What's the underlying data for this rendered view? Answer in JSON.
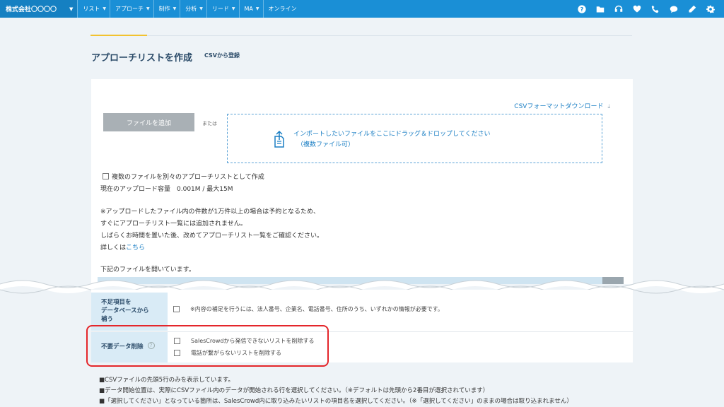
{
  "nav": {
    "brand": "株式会社〇〇〇〇",
    "menu": [
      {
        "label": "リスト",
        "has_dropdown": true
      },
      {
        "label": "アプローチ",
        "has_dropdown": true
      },
      {
        "label": "制作",
        "has_dropdown": true
      },
      {
        "label": "分析",
        "has_dropdown": true
      },
      {
        "label": "リード",
        "has_dropdown": true
      },
      {
        "label": "MA",
        "has_dropdown": true
      },
      {
        "label": "オンライン",
        "has_dropdown": false
      }
    ],
    "icons": [
      "help-icon",
      "folder-icon",
      "headset-icon",
      "heart-icon",
      "phone-icon",
      "chat-icon",
      "pencil-icon",
      "gear-icon"
    ],
    "bg_color": "#1a8fd6"
  },
  "page": {
    "title": "アプローチリストを作成",
    "subtitle": "CSVから登録"
  },
  "upload": {
    "csv_format_link": "CSVフォーマットダウンロード",
    "add_file_label": "ファイルを追加",
    "or_text": "または",
    "drop_line1": "インポートしたいファイルをここにドラッグ＆ドロップしてください",
    "drop_line2": "（複数ファイル可）",
    "multi_file_label": "複数のファイルを別々のアプローチリストとして作成",
    "capacity_text": "現在のアップロード容量　0.001M / 最大15M",
    "note_line1": "※アップロードしたファイル内の件数が1万件以上の場合は予約となるため、",
    "note_line2": "すぐにアプローチリスト一覧には追加されません。",
    "note_line3": "しばらくお時間を置いた後、改めてアプローチリスト一覧をご確認ください。",
    "details_prefix": "詳しくは",
    "details_link": "こちら",
    "opening_text": "下記のファイルを開いています。"
  },
  "settings": {
    "supplement_heading": [
      "不足項目を",
      "データベースから",
      "補う"
    ],
    "supplement_note": "※内容の補足を行うには、法人番号、企業名、電話番号、住所のうち、いずれかの情報が必要です。",
    "cleanup_heading": "不要データ削除",
    "cleanup_option1": "SalesCrowdから発信できないリストを削除する",
    "cleanup_option2": "電話が繋がらないリストを削除する"
  },
  "footer_notes": [
    "■CSVファイルの先頭5行のみを表示しています。",
    "■データ開始位置は、実際にCSVファイル内のデータが開始される行を選択してください。（※デフォルトは先頭から2番目が選択されています）",
    "■「選択してください」となっている箇所は、SalesCrowd内に取り込みたいリストの項目名を選択してください。（※「選択してください」のままの場合は取り込まれません）"
  ],
  "colors": {
    "accent": "#1a8fd6",
    "link": "#1b7fc4",
    "highlight": "#e4262b",
    "heading_bg": "#d9ebf6"
  }
}
